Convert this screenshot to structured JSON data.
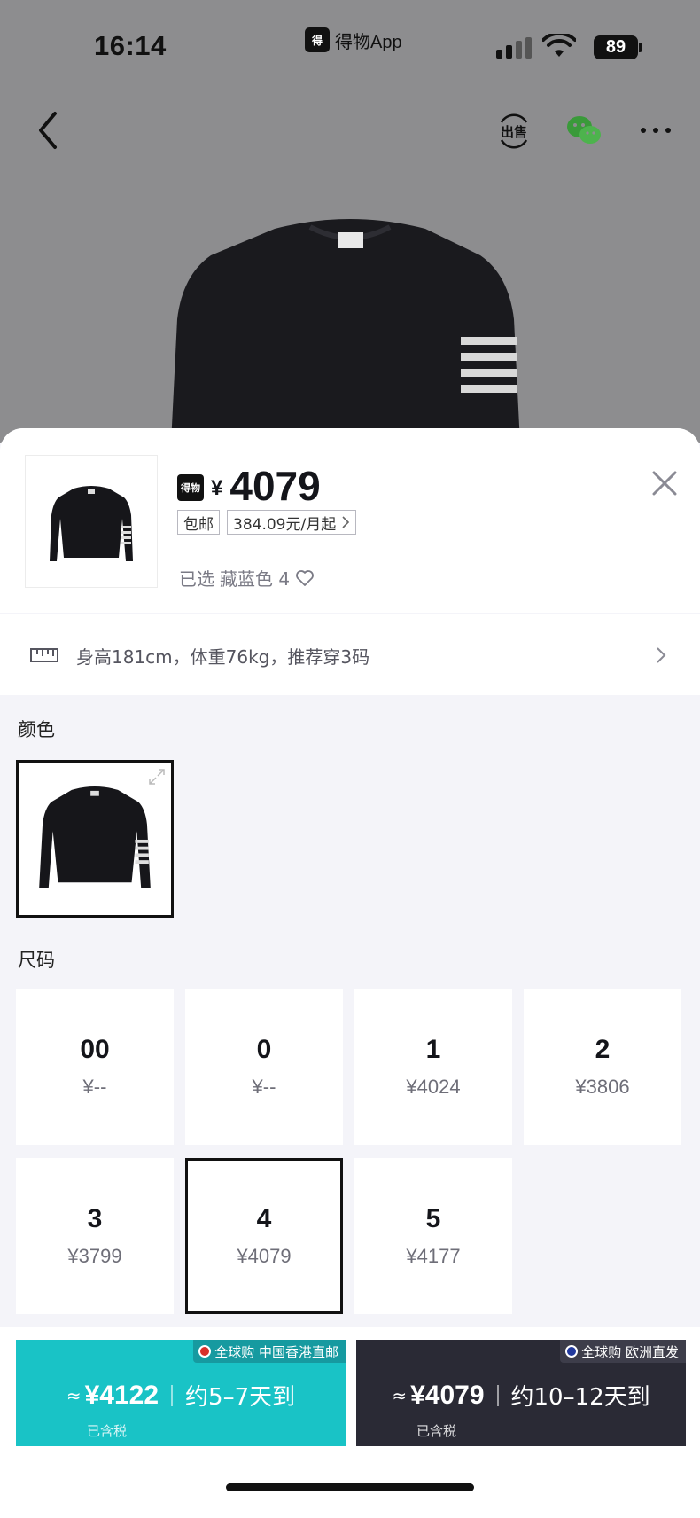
{
  "status_bar": {
    "time": "16:14",
    "app_name": "得物App",
    "battery": "89"
  },
  "nav": {
    "back_icon": "chevron-left-icon",
    "sell_label": "出售",
    "share_icon": "wechat-icon",
    "more_icon": "more-icon"
  },
  "sheet": {
    "brand_badge": "得物",
    "price_symbol": "¥",
    "price": "4079",
    "free_shipping_tag": "包邮",
    "installment_tag": "384.09元/月起",
    "selected_prefix": "已选",
    "selected_value": "藏蓝色 4",
    "recommendation": "身高181cm，体重76kg，推荐穿3码",
    "color_title": "颜色",
    "size_title": "尺码"
  },
  "sizes": [
    {
      "label": "00",
      "price": "¥--"
    },
    {
      "label": "0",
      "price": "¥--"
    },
    {
      "label": "1",
      "price": "¥4024"
    },
    {
      "label": "2",
      "price": "¥3806"
    },
    {
      "label": "3",
      "price": "¥3799"
    },
    {
      "label": "4",
      "price": "¥4079"
    },
    {
      "label": "5",
      "price": "¥4177"
    }
  ],
  "selected_size": "4",
  "buy": {
    "hk": {
      "badge": "全球购 中国香港直邮",
      "approx": "≈",
      "price": "¥4122",
      "eta": "约5–7天到",
      "tax": "已含税"
    },
    "eu": {
      "badge": "全球购 欧洲直发",
      "approx": "≈",
      "price": "¥4079",
      "eta": "约10–12天到",
      "tax": "已含税"
    }
  },
  "colors": {
    "hk_button": "#19c3c6",
    "eu_button": "#2a2a35",
    "hk_flag": "#d9302b",
    "eu_flag": "#233a9e",
    "wechat_green": "#3a9a3a"
  }
}
